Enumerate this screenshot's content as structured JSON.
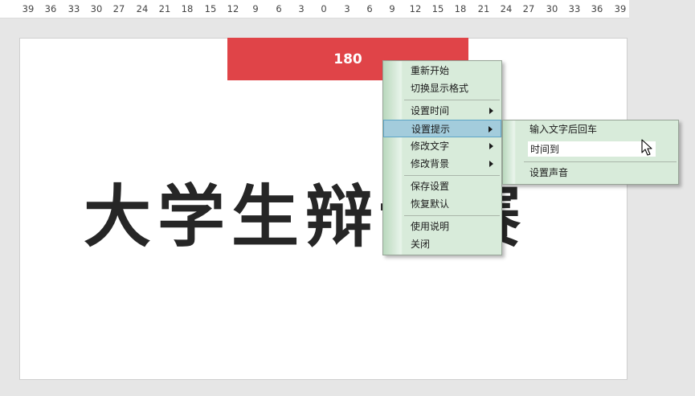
{
  "ruler": {
    "ticks": [
      "39",
      "36",
      "33",
      "30",
      "27",
      "24",
      "21",
      "18",
      "15",
      "12",
      "9",
      "6",
      "3",
      "0",
      "3",
      "6",
      "9",
      "12",
      "15",
      "18",
      "21",
      "24",
      "27",
      "30",
      "33",
      "36",
      "39"
    ]
  },
  "slide": {
    "timer_value": "180",
    "timer_color": "#e04448",
    "title": "大学生辩论赛"
  },
  "context_menu": {
    "items": [
      {
        "label": "重新开始"
      },
      {
        "label": "切换显示格式"
      },
      {
        "label": "设置时间"
      },
      {
        "label": "设置提示"
      },
      {
        "label": "修改文字"
      },
      {
        "label": "修改背景"
      },
      {
        "label": "保存设置"
      },
      {
        "label": "恢复默认"
      },
      {
        "label": "使用说明"
      },
      {
        "label": "关闭"
      }
    ]
  },
  "submenu": {
    "item_enter_text": "输入文字后回车",
    "input_value": "时间到",
    "item_set_sound": "设置声音"
  },
  "icons": {
    "submenu_arrow": "chevron-right-icon",
    "cursor": "mouse-pointer-icon"
  }
}
